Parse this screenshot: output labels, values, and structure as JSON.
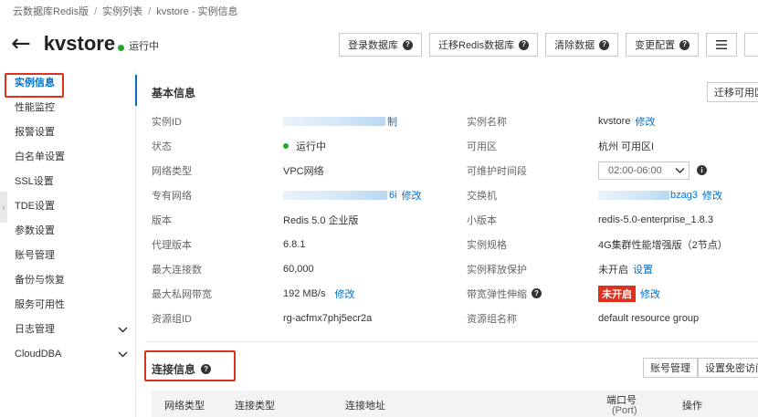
{
  "breadcrumb": {
    "items": [
      "云数据库Redis版",
      "实例列表",
      "kvstore - 实例信息"
    ],
    "sep": "/"
  },
  "header": {
    "back_icon": "arrow-left-icon",
    "title": "kvstore",
    "status": "运行中",
    "status_color": "#1cab29"
  },
  "toolbar": {
    "login_db": "登录数据库",
    "migrate_redis": "迁移Redis数据库",
    "clear_data": "清除数据",
    "change_config": "变更配置",
    "menu_icon": "hamburger-menu-icon"
  },
  "sidebar": {
    "items": [
      {
        "label": "实例信息",
        "active": true
      },
      {
        "label": "性能监控"
      },
      {
        "label": "报警设置"
      },
      {
        "label": "白名单设置"
      },
      {
        "label": "SSL设置"
      },
      {
        "label": "TDE设置"
      },
      {
        "label": "参数设置"
      },
      {
        "label": "账号管理"
      },
      {
        "label": "备份与恢复"
      },
      {
        "label": "服务可用性"
      },
      {
        "label": "日志管理",
        "expandable": true
      },
      {
        "label": "CloudDBA",
        "expandable": true
      }
    ],
    "chevron": "⌄"
  },
  "basic": {
    "title": "基本信息",
    "migrate_zone": "迁移可用区",
    "instance_id_label": "实例ID",
    "instance_id_suffix": "制",
    "instance_name_label": "实例名称",
    "instance_name": "kvstore",
    "edit": "修改",
    "status_label": "状态",
    "status": "运行中",
    "zone_label": "可用区",
    "zone": "杭州 可用区I",
    "network_type_label": "网络类型",
    "network_type": "VPC网络",
    "maint_label": "可维护时间段",
    "maint_window": "02:00-06:00",
    "vpc_label": "专有网络",
    "vpc_suffix": "6i",
    "switch_label": "交换机",
    "switch_suffix": "bzag3",
    "version_label": "版本",
    "version": "Redis 5.0 企业版",
    "minor_label": "小版本",
    "minor": "redis-5.0-enterprise_1.8.3",
    "proxy_label": "代理版本",
    "proxy": "6.8.1",
    "spec_label": "实例规格",
    "spec": "4G集群性能增强版（2节点）",
    "maxconn_label": "最大连接数",
    "maxconn": "60,000",
    "release_label": "实例释放保护",
    "release": "未开启",
    "settings": "设置",
    "bandwidth_label": "最大私网带宽",
    "bandwidth": "192 MB/s",
    "elastic_label": "带宽弹性伸缩",
    "elastic": "未开启",
    "rg_id_label": "资源组ID",
    "rg_id": "rg-acfmx7phj5ecr2a",
    "rg_name_label": "资源组名称",
    "rg_name": "default resource group"
  },
  "connection": {
    "title": "连接信息",
    "account_btn": "账号管理",
    "nopass_btn": "设置免密访问",
    "headers": [
      "网络类型",
      "连接类型",
      "连接地址",
      "端口号",
      "(Port)",
      "操作"
    ]
  },
  "colors": {
    "accent": "#0070cc",
    "highlight": "#e0301e",
    "running": "#1cab29"
  }
}
